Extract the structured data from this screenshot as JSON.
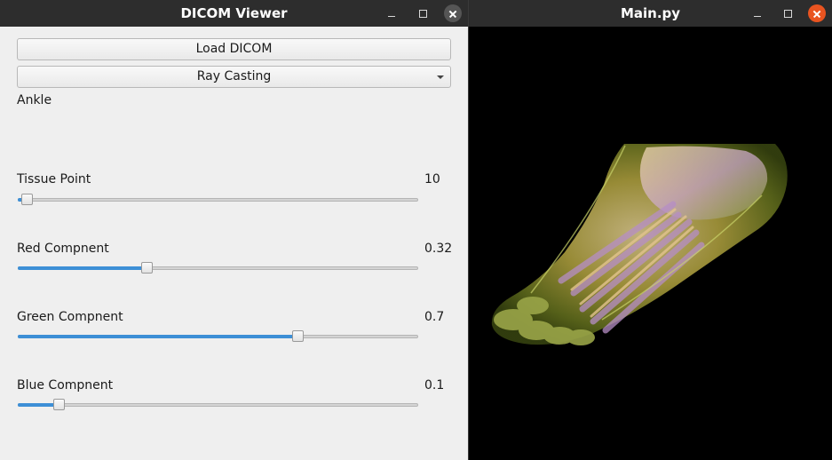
{
  "left_window": {
    "title": "DICOM Viewer",
    "load_button": "Load DICOM",
    "render_mode": {
      "selected": "Ray Casting"
    },
    "dataset_label": "Ankle",
    "sliders": [
      {
        "label": "Tissue Point",
        "value": "10",
        "fraction": 0.02
      },
      {
        "label": "Red Compnent",
        "value": "0.32",
        "fraction": 0.32
      },
      {
        "label": "Green Compnent",
        "value": "0.7",
        "fraction": 0.7
      },
      {
        "label": "Blue Compnent",
        "value": "0.1",
        "fraction": 0.1
      }
    ]
  },
  "right_window": {
    "title": "Main.py",
    "render_view": "3D volume rendering of ankle/foot bones"
  },
  "colors": {
    "titlebar": "#2d2d2d",
    "close_button": "#e95420",
    "close_button_inactive": "#555555",
    "panel_bg": "#efefef",
    "slider_fill": "#3d8fd6"
  },
  "icons": [
    "minimize-icon",
    "maximize-icon",
    "close-icon",
    "chevron-down-icon"
  ]
}
